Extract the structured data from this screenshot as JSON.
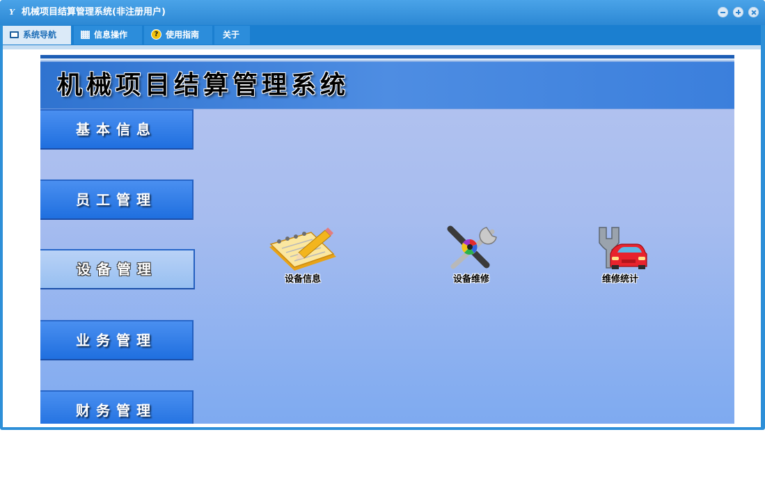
{
  "window": {
    "title": "机械项目结算管理系统(非注册用户)",
    "app_icon_glyph": "Y",
    "controls": [
      "minimize-icon",
      "maximize-icon",
      "close-icon"
    ]
  },
  "menu": {
    "tabs": [
      {
        "label": "系统导航",
        "icon": "monitor-icon",
        "active": true
      },
      {
        "label": "信息操作",
        "icon": "grid-icon",
        "active": false
      },
      {
        "label": "使用指南",
        "icon": "help-icon",
        "active": false
      },
      {
        "label": "关于",
        "icon": "",
        "active": false
      }
    ],
    "help_glyph": "?"
  },
  "banner": {
    "title": "机械项目结算管理系统"
  },
  "sidebar": {
    "items": [
      {
        "label": "基本信息",
        "active": false
      },
      {
        "label": "员工管理",
        "active": false
      },
      {
        "label": "设备管理",
        "active": true
      },
      {
        "label": "业务管理",
        "active": false
      },
      {
        "label": "财务管理",
        "active": false
      }
    ]
  },
  "tools": [
    {
      "label": "设备信息",
      "icon": "notebook-pencil-icon"
    },
    {
      "label": "设备维修",
      "icon": "screwdriver-wrench-icon"
    },
    {
      "label": "维修统计",
      "icon": "car-wrench-icon"
    }
  ],
  "colors": {
    "titlebar": "#2c88d4",
    "menubar": "#1b7fd0",
    "side_button": "#2a78e4",
    "side_button_active": "#a9c9f4",
    "panel_top": "#b5c4ef",
    "panel_bottom": "#7eaaf0"
  }
}
